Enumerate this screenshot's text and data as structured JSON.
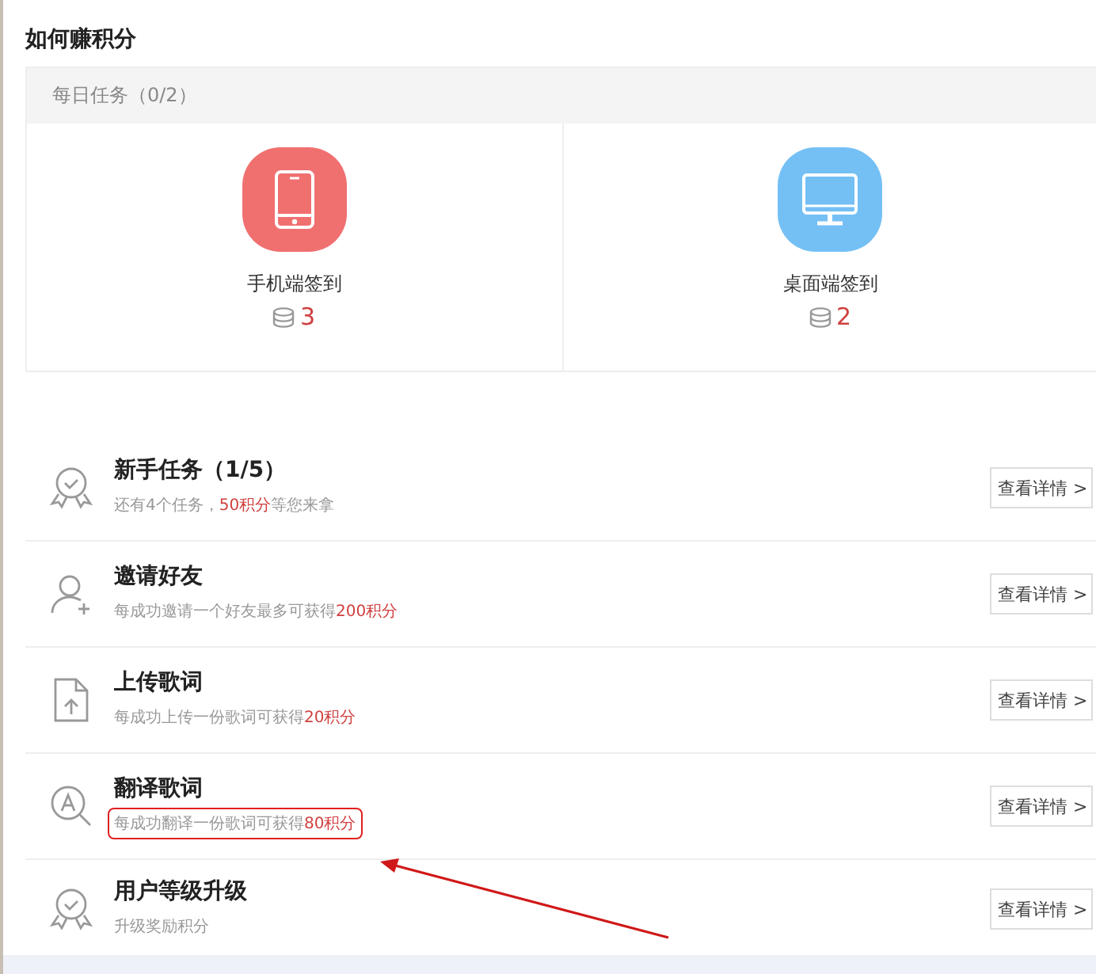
{
  "title": "如何赚积分",
  "daily": {
    "header": "每日任务（0/2）",
    "cards": [
      {
        "kind": "phone",
        "color": "#f07070",
        "label": "手机端签到",
        "points": "3"
      },
      {
        "kind": "desktop",
        "color": "#74c0f5",
        "label": "桌面端签到",
        "points": "2"
      }
    ]
  },
  "tasks": [
    {
      "kind": "badge",
      "title": "新手任务（1/5）",
      "detail": [
        {
          "text": "还有4个任务，",
          "highlight": false
        },
        {
          "text": "50积分",
          "highlight": true
        },
        {
          "text": "等您来拿",
          "highlight": false
        }
      ],
      "button": "查看详情 >",
      "annotated": false
    },
    {
      "kind": "user-add",
      "title": "邀请好友",
      "detail": [
        {
          "text": "每成功邀请一个好友最多可获得",
          "highlight": false
        },
        {
          "text": "200积分",
          "highlight": true
        }
      ],
      "button": "查看详情 >",
      "annotated": false
    },
    {
      "kind": "upload",
      "title": "上传歌词",
      "detail": [
        {
          "text": "每成功上传一份歌词可获得",
          "highlight": false
        },
        {
          "text": "20积分",
          "highlight": true
        }
      ],
      "button": "查看详情 >",
      "annotated": false
    },
    {
      "kind": "translate",
      "title": "翻译歌词",
      "detail": [
        {
          "text": "每成功翻译一份歌词可获得",
          "highlight": false
        },
        {
          "text": "80积分",
          "highlight": true
        }
      ],
      "button": "查看详情 >",
      "annotated": true
    },
    {
      "kind": "badge",
      "title": "用户等级升级",
      "detail": [
        {
          "text": "升级奖励积分",
          "highlight": false
        }
      ],
      "button": "查看详情 >",
      "annotated": false
    }
  ]
}
